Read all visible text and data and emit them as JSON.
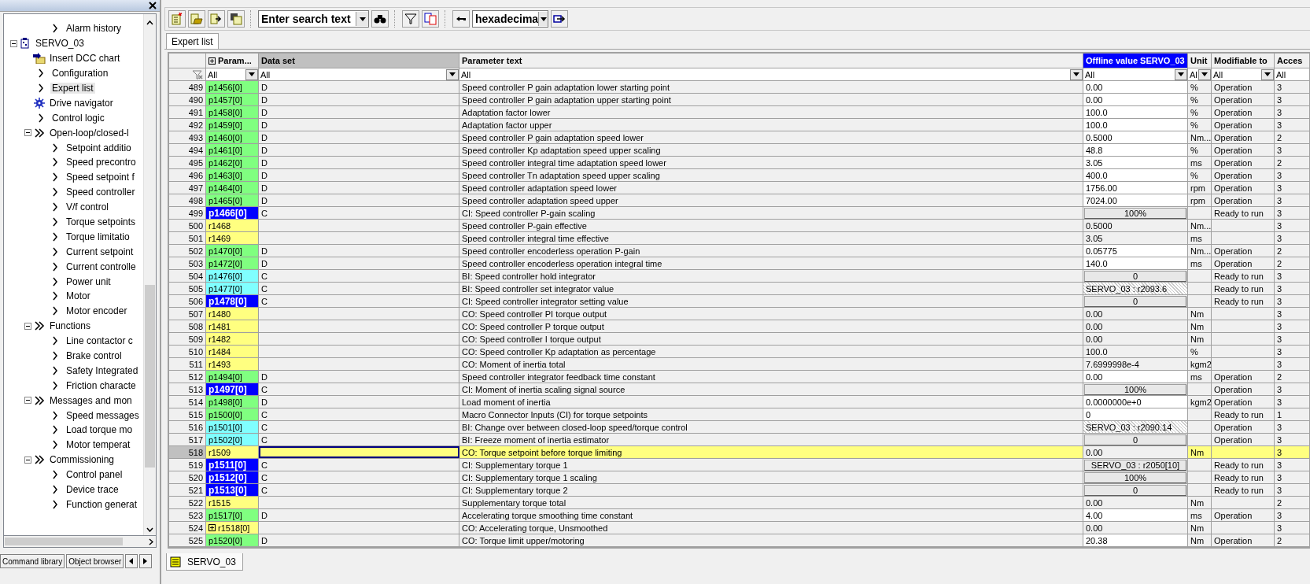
{
  "left_panel": {
    "tree": {
      "scrolled_branch": [
        {
          "label": "Alarm history",
          "kind": "chevron",
          "selected": false
        }
      ],
      "items": [
        {
          "label": "SERVO_03",
          "kind": "drive",
          "selected": false,
          "expanded": true,
          "children": [
            {
              "label": "Insert DCC chart",
              "kind": "dcc",
              "selected": false
            },
            {
              "label": "Configuration",
              "kind": "chevron",
              "selected": false
            },
            {
              "label": "Expert list",
              "kind": "chevron",
              "selected": true
            },
            {
              "label": "Drive navigator",
              "kind": "navigator",
              "selected": false
            },
            {
              "label": "Control logic",
              "kind": "chevron",
              "selected": false
            },
            {
              "label": "Open-loop/closed-l",
              "kind": "double",
              "selected": false,
              "expanded": true,
              "children": [
                {
                  "label": "Setpoint additio",
                  "kind": "chevron",
                  "selected": false
                },
                {
                  "label": "Speed precontro",
                  "kind": "chevron",
                  "selected": false
                },
                {
                  "label": "Speed setpoint f",
                  "kind": "chevron",
                  "selected": false
                },
                {
                  "label": "Speed controller",
                  "kind": "chevron",
                  "selected": false
                },
                {
                  "label": "V/f control",
                  "kind": "chevron",
                  "selected": false
                },
                {
                  "label": "Torque setpoints",
                  "kind": "chevron",
                  "selected": false
                },
                {
                  "label": "Torque limitatio",
                  "kind": "chevron",
                  "selected": false
                },
                {
                  "label": "Current setpoint",
                  "kind": "chevron",
                  "selected": false
                },
                {
                  "label": "Current controlle",
                  "kind": "chevron",
                  "selected": false
                },
                {
                  "label": "Power unit",
                  "kind": "chevron",
                  "selected": false
                },
                {
                  "label": "Motor",
                  "kind": "chevron",
                  "selected": false
                },
                {
                  "label": "Motor encoder",
                  "kind": "chevron",
                  "selected": false
                }
              ]
            },
            {
              "label": "Functions",
              "kind": "double",
              "selected": false,
              "expanded": true,
              "children": [
                {
                  "label": "Line contactor c",
                  "kind": "chevron",
                  "selected": false
                },
                {
                  "label": "Brake control",
                  "kind": "chevron",
                  "selected": false
                },
                {
                  "label": "Safety Integrated",
                  "kind": "chevron",
                  "selected": false
                },
                {
                  "label": "Friction characte",
                  "kind": "chevron",
                  "selected": false
                }
              ]
            },
            {
              "label": "Messages and mon",
              "kind": "double",
              "selected": false,
              "expanded": true,
              "children": [
                {
                  "label": "Speed messages",
                  "kind": "chevron",
                  "selected": false
                },
                {
                  "label": "Load torque mo",
                  "kind": "chevron",
                  "selected": false
                },
                {
                  "label": "Motor temperat",
                  "kind": "chevron",
                  "selected": false
                }
              ]
            },
            {
              "label": "Commissioning",
              "kind": "double",
              "selected": false,
              "expanded": true,
              "children": [
                {
                  "label": "Control panel",
                  "kind": "chevron",
                  "selected": false
                },
                {
                  "label": "Device trace",
                  "kind": "chevron",
                  "selected": false
                },
                {
                  "label": "Function generat",
                  "kind": "chevron",
                  "selected": false
                }
              ]
            }
          ]
        }
      ]
    },
    "tabs": [
      {
        "label": "Command library",
        "selected": false
      },
      {
        "label": "Object browser",
        "selected": false
      }
    ]
  },
  "toolbar": {
    "search": {
      "value": "Enter search text"
    },
    "number_format": {
      "value": "hexadecima"
    }
  },
  "tabs": [
    {
      "label": "Expert list",
      "selected": true
    }
  ],
  "table": {
    "columns": [
      {
        "kind": "plain"
      },
      {
        "label": "Param...",
        "kind": "plain"
      },
      {
        "label": "Data set",
        "kind": "sorted"
      },
      {
        "label": "Parameter text",
        "kind": "plain"
      },
      {
        "label": "Offline value SERVO_03",
        "kind": "active"
      },
      {
        "label": "Unit",
        "kind": "plain"
      },
      {
        "label": "Modifiable to",
        "kind": "plain"
      },
      {
        "label": "Acces",
        "kind": "plain"
      }
    ],
    "filters": [
      {
        "kind": "clear"
      },
      {
        "kind": "dropdown",
        "value": "All"
      },
      {
        "kind": "dropdown",
        "value": "All"
      },
      {
        "kind": "dropdown",
        "value": "All"
      },
      {
        "kind": "dropdown",
        "value": "All"
      },
      {
        "kind": "dropdown",
        "value": "Al"
      },
      {
        "kind": "dropdown",
        "value": "All"
      },
      {
        "kind": "text",
        "value": "All"
      }
    ],
    "rows": [
      {
        "n": "489",
        "param": "p1456[0]",
        "color": "#80ff80",
        "ds": "D",
        "text": "Speed controller P gain adaptation lower starting point",
        "value": "0.00",
        "kind": "edit",
        "unit": "%",
        "mod": "Operation",
        "acc": "3",
        "selected": false,
        "expandable": false
      },
      {
        "n": "490",
        "param": "p1457[0]",
        "color": "#80ff80",
        "ds": "D",
        "text": "Speed controller P gain adaptation upper starting point",
        "value": "0.00",
        "kind": "edit",
        "unit": "%",
        "mod": "Operation",
        "acc": "3",
        "selected": false,
        "expandable": false
      },
      {
        "n": "491",
        "param": "p1458[0]",
        "color": "#80ff80",
        "ds": "D",
        "text": "Adaptation factor lower",
        "value": "100.0",
        "kind": "edit",
        "unit": "%",
        "mod": "Operation",
        "acc": "3",
        "selected": false,
        "expandable": false
      },
      {
        "n": "492",
        "param": "p1459[0]",
        "color": "#80ff80",
        "ds": "D",
        "text": "Adaptation factor upper",
        "value": "100.0",
        "kind": "edit",
        "unit": "%",
        "mod": "Operation",
        "acc": "3",
        "selected": false,
        "expandable": false
      },
      {
        "n": "493",
        "param": "p1460[0]",
        "color": "#80ff80",
        "ds": "D",
        "text": "Speed controller P gain adaptation speed lower",
        "value": "0.5000",
        "kind": "edit",
        "unit": "Nm...",
        "mod": "Operation",
        "acc": "2",
        "selected": false,
        "expandable": false
      },
      {
        "n": "494",
        "param": "p1461[0]",
        "color": "#80ff80",
        "ds": "D",
        "text": "Speed controller Kp adaptation speed upper scaling",
        "value": "48.8",
        "kind": "edit",
        "unit": "%",
        "mod": "Operation",
        "acc": "3",
        "selected": false,
        "expandable": false
      },
      {
        "n": "495",
        "param": "p1462[0]",
        "color": "#80ff80",
        "ds": "D",
        "text": "Speed controller integral time adaptation speed lower",
        "value": "3.05",
        "kind": "edit",
        "unit": "ms",
        "mod": "Operation",
        "acc": "2",
        "selected": false,
        "expandable": false
      },
      {
        "n": "496",
        "param": "p1463[0]",
        "color": "#80ff80",
        "ds": "D",
        "text": "Speed controller Tn adaptation speed upper scaling",
        "value": "400.0",
        "kind": "edit",
        "unit": "%",
        "mod": "Operation",
        "acc": "3",
        "selected": false,
        "expandable": false
      },
      {
        "n": "497",
        "param": "p1464[0]",
        "color": "#80ff80",
        "ds": "D",
        "text": "Speed controller adaptation speed lower",
        "value": "1756.00",
        "kind": "edit",
        "unit": "rpm",
        "mod": "Operation",
        "acc": "3",
        "selected": false,
        "expandable": false
      },
      {
        "n": "498",
        "param": "p1465[0]",
        "color": "#80ff80",
        "ds": "D",
        "text": "Speed controller adaptation speed upper",
        "value": "7024.00",
        "kind": "edit",
        "unit": "rpm",
        "mod": "Operation",
        "acc": "3",
        "selected": false,
        "expandable": false
      },
      {
        "n": "499",
        "param": "p1466[0]",
        "color": "#0000ff",
        "ds": "C",
        "text": "CI: Speed controller P-gain scaling",
        "value": "100%",
        "kind": "button",
        "mod": "Ready to run",
        "acc": "3",
        "selected": false,
        "expandable": false
      },
      {
        "n": "500",
        "param": "r1468",
        "color": "#ffff80",
        "text": "Speed controller P-gain effective",
        "value": "0.5000",
        "kind": "read",
        "unit": "Nm...",
        "acc": "3",
        "selected": false,
        "expandable": false
      },
      {
        "n": "501",
        "param": "r1469",
        "color": "#ffff80",
        "text": "Speed controller integral time effective",
        "value": "3.05",
        "kind": "read",
        "unit": "ms",
        "acc": "3",
        "selected": false,
        "expandable": false
      },
      {
        "n": "502",
        "param": "p1470[0]",
        "color": "#80ff80",
        "ds": "D",
        "text": "Speed controller encoderless operation P-gain",
        "value": "0.05775",
        "kind": "edit",
        "unit": "Nm...",
        "mod": "Operation",
        "acc": "2",
        "selected": false,
        "expandable": false
      },
      {
        "n": "503",
        "param": "p1472[0]",
        "color": "#80ff80",
        "ds": "D",
        "text": "Speed controller encoderless operation integral time",
        "value": "140.0",
        "kind": "edit",
        "unit": "ms",
        "mod": "Operation",
        "acc": "2",
        "selected": false,
        "expandable": false
      },
      {
        "n": "504",
        "param": "p1476[0]",
        "color": "#80ffff",
        "ds": "C",
        "text": "BI: Speed controller hold integrator",
        "value": "0",
        "kind": "button",
        "mod": "Ready to run",
        "acc": "3",
        "selected": false,
        "expandable": false
      },
      {
        "n": "505",
        "param": "p1477[0]",
        "color": "#80ffff",
        "ds": "C",
        "text": "BI: Speed controller set integrator value",
        "value": "SERVO_03 : r2093.6",
        "kind": "hatched",
        "mod": "Ready to run",
        "acc": "3",
        "selected": false,
        "expandable": false
      },
      {
        "n": "506",
        "param": "p1478[0]",
        "color": "#0000ff",
        "ds": "C",
        "text": "CI: Speed controller integrator setting value",
        "value": "0",
        "kind": "button",
        "mod": "Ready to run",
        "acc": "3",
        "selected": false,
        "expandable": false
      },
      {
        "n": "507",
        "param": "r1480",
        "color": "#ffff80",
        "text": "CO: Speed controller PI torque output",
        "value": "0.00",
        "kind": "read",
        "unit": "Nm",
        "acc": "3",
        "selected": false,
        "expandable": false
      },
      {
        "n": "508",
        "param": "r1481",
        "color": "#ffff80",
        "text": "CO: Speed controller P torque output",
        "value": "0.00",
        "kind": "read",
        "unit": "Nm",
        "acc": "3",
        "selected": false,
        "expandable": false
      },
      {
        "n": "509",
        "param": "r1482",
        "color": "#ffff80",
        "text": "CO: Speed controller I torque output",
        "value": "0.00",
        "kind": "read",
        "unit": "Nm",
        "acc": "3",
        "selected": false,
        "expandable": false
      },
      {
        "n": "510",
        "param": "r1484",
        "color": "#ffff80",
        "text": "CO: Speed controller Kp adaptation as percentage",
        "value": "100.0",
        "kind": "read",
        "unit": "%",
        "acc": "3",
        "selected": false,
        "expandable": false
      },
      {
        "n": "511",
        "param": "r1493",
        "color": "#ffff80",
        "text": "CO: Moment of inertia total",
        "value": "7.6999998e-4",
        "kind": "read",
        "unit": "kgm2",
        "acc": "3",
        "selected": false,
        "expandable": false
      },
      {
        "n": "512",
        "param": "p1494[0]",
        "color": "#80ff80",
        "ds": "D",
        "text": "Speed controller integrator feedback time constant",
        "value": "0.00",
        "kind": "edit",
        "unit": "ms",
        "mod": "Operation",
        "acc": "2",
        "selected": false,
        "expandable": false
      },
      {
        "n": "513",
        "param": "p1497[0]",
        "color": "#0000ff",
        "ds": "C",
        "text": "CI: Moment of inertia scaling signal source",
        "value": "100%",
        "kind": "button",
        "mod": "Operation",
        "acc": "3",
        "selected": false,
        "expandable": false
      },
      {
        "n": "514",
        "param": "p1498[0]",
        "color": "#80ff80",
        "ds": "D",
        "text": "Load moment of inertia",
        "value": "0.0000000e+0",
        "kind": "edit",
        "unit": "kgm2",
        "mod": "Operation",
        "acc": "3",
        "selected": false,
        "expandable": false
      },
      {
        "n": "515",
        "param": "p1500[0]",
        "color": "#80ff80",
        "ds": "C",
        "text": "Macro Connector Inputs (CI) for torque setpoints",
        "value": "0",
        "kind": "edit",
        "mod": "Ready to run",
        "acc": "1",
        "selected": false,
        "expandable": false
      },
      {
        "n": "516",
        "param": "p1501[0]",
        "color": "#80ffff",
        "ds": "C",
        "text": "BI: Change over between closed-loop speed/torque control",
        "value": "SERVO_03 : r2090.14",
        "kind": "hatched",
        "mod": "Operation",
        "acc": "3",
        "selected": false,
        "expandable": false
      },
      {
        "n": "517",
        "param": "p1502[0]",
        "color": "#80ffff",
        "ds": "C",
        "text": "BI: Freeze moment of inertia estimator",
        "value": "0",
        "kind": "button",
        "mod": "Operation",
        "acc": "3",
        "selected": false,
        "expandable": false
      },
      {
        "n": "518",
        "param": "r1509",
        "color": "#ffff80",
        "text": "CO: Torque setpoint before torque limiting",
        "value": "0.00",
        "kind": "read",
        "unit": "Nm",
        "acc": "3",
        "selected": true,
        "expandable": false
      },
      {
        "n": "519",
        "param": "p1511[0]",
        "color": "#0000ff",
        "ds": "C",
        "text": "CI: Supplementary torque 1",
        "value": "SERVO_03 : r2050[10]",
        "kind": "button",
        "mod": "Ready to run",
        "acc": "3",
        "selected": false,
        "expandable": false
      },
      {
        "n": "520",
        "param": "p1512[0]",
        "color": "#0000ff",
        "ds": "C",
        "text": "CI: Supplementary torque 1 scaling",
        "value": "100%",
        "kind": "button",
        "mod": "Ready to run",
        "acc": "3",
        "selected": false,
        "expandable": false
      },
      {
        "n": "521",
        "param": "p1513[0]",
        "color": "#0000ff",
        "ds": "C",
        "text": "CI: Supplementary torque 2",
        "value": "0",
        "kind": "button",
        "mod": "Ready to run",
        "acc": "3",
        "selected": false,
        "expandable": false
      },
      {
        "n": "522",
        "param": "r1515",
        "color": "#ffff80",
        "text": "Supplementary torque total",
        "value": "0.00",
        "kind": "read",
        "unit": "Nm",
        "acc": "2",
        "selected": false,
        "expandable": false
      },
      {
        "n": "523",
        "param": "p1517[0]",
        "color": "#80ff80",
        "ds": "D",
        "text": "Accelerating torque smoothing time constant",
        "value": "4.00",
        "kind": "edit",
        "unit": "ms",
        "mod": "Operation",
        "acc": "3",
        "selected": false,
        "expandable": false
      },
      {
        "n": "524",
        "param": "r1518[0]",
        "color": "#ffff80",
        "text": "CO: Accelerating torque, Unsmoothed",
        "value": "0.00",
        "kind": "read",
        "unit": "Nm",
        "acc": "3",
        "selected": false,
        "expandable": true
      },
      {
        "n": "525",
        "param": "p1520[0]",
        "color": "#80ff80",
        "ds": "D",
        "text": "CO: Torque limit upper/motoring",
        "value": "20.38",
        "kind": "edit",
        "unit": "Nm",
        "mod": "Operation",
        "acc": "2",
        "selected": false,
        "expandable": false
      }
    ]
  },
  "document_tabs": [
    {
      "label": "SERVO_03",
      "selected": true
    }
  ]
}
